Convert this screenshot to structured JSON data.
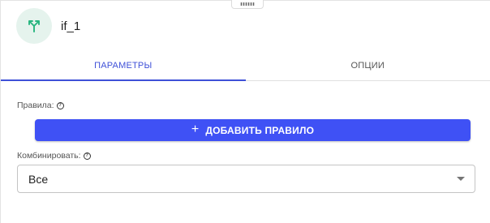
{
  "node": {
    "title": "if_1",
    "icon": "branch-split-icon",
    "icon_color": "#26b57f",
    "icon_bg": "#e5f3ed"
  },
  "tabs": [
    {
      "label": "ПАРАМЕТРЫ",
      "active": true
    },
    {
      "label": "ОПЦИИ",
      "active": false
    }
  ],
  "rules": {
    "label": "Правила:",
    "add_button_label": "ДОБАВИТЬ ПРАВИЛО",
    "add_button_color": "#3f51f5"
  },
  "combine": {
    "label": "Комбинировать:",
    "selected_value": "Все"
  },
  "accent_color": "#3f51d8"
}
